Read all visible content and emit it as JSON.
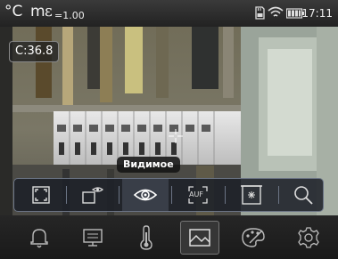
{
  "status_bar": {
    "unit_celsius": "°C",
    "unit_m": "m",
    "unit_epsilon": "ε",
    "emissivity": "=1.00",
    "time": "17:11",
    "icons": [
      "sd-card-icon",
      "wifi-icon",
      "battery-icon"
    ]
  },
  "readout": {
    "temperature": "C:36.8"
  },
  "overlay": {
    "mode_label": "Видимое"
  },
  "toolbar": {
    "items": [
      {
        "name": "fullscreen-icon"
      },
      {
        "name": "measure-overlay-icon"
      },
      {
        "name": "eye-icon",
        "selected": true
      },
      {
        "name": "auto-focus-icon",
        "text": "AUF"
      },
      {
        "name": "center-point-icon"
      },
      {
        "name": "zoom-icon"
      }
    ]
  },
  "bottom_menu": {
    "items": [
      {
        "name": "alarm-bell-icon"
      },
      {
        "name": "display-icon"
      },
      {
        "name": "thermometer-icon"
      },
      {
        "name": "image-mode-icon",
        "selected": true
      },
      {
        "name": "palette-icon"
      },
      {
        "name": "settings-gear-icon"
      }
    ]
  },
  "colors": {
    "accent": "#ffffff",
    "toolbar_border": "#6b7485"
  }
}
